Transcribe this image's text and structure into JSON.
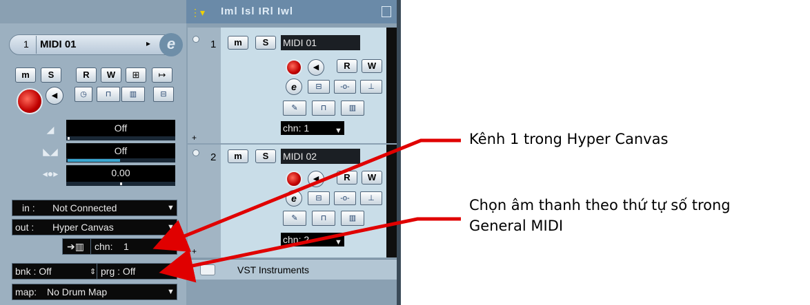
{
  "inspector": {
    "track_number": "1",
    "track_name": "MIDI 01",
    "arrow": "▸",
    "edit_button": "e",
    "buttons_row1": [
      "m",
      "S",
      "R",
      "W",
      "⊞",
      "↦"
    ],
    "volume_value": "Off",
    "pan_value": "Off",
    "delay_value": "0.00",
    "input_label": "in :",
    "input_value": "Not Connected",
    "output_label": "out :",
    "output_value": "Hyper Canvas",
    "channel_label": "chn:",
    "channel_value": "1",
    "bank_label": "bnk : Off",
    "program_label": "prg : Off",
    "map_label": "map:",
    "map_value": "No Drum Map"
  },
  "tracklist": {
    "header_title": "Iml Isl IRl Iwl",
    "tracks": [
      {
        "number": "1",
        "mute": "m",
        "solo": "S",
        "name": "MIDI 01",
        "read": "R",
        "write": "W",
        "channel": "chn: 1"
      },
      {
        "number": "2",
        "mute": "m",
        "solo": "S",
        "name": "MIDI 02",
        "read": "R",
        "write": "W",
        "channel": "chn: 2"
      }
    ],
    "folder_name": "VST Instruments",
    "plus": "+"
  },
  "annotations": {
    "channel_note": "Kênh 1 trong Hyper Canvas",
    "program_note_line1": "Chọn âm thanh theo thứ tự số trong",
    "program_note_line2": "General MIDI"
  },
  "colors": {
    "panel": "#9cb0c0",
    "track_bg": "#c9dde8",
    "arrow_red": "#e00000",
    "meter_blue": "#3aa6d0"
  }
}
